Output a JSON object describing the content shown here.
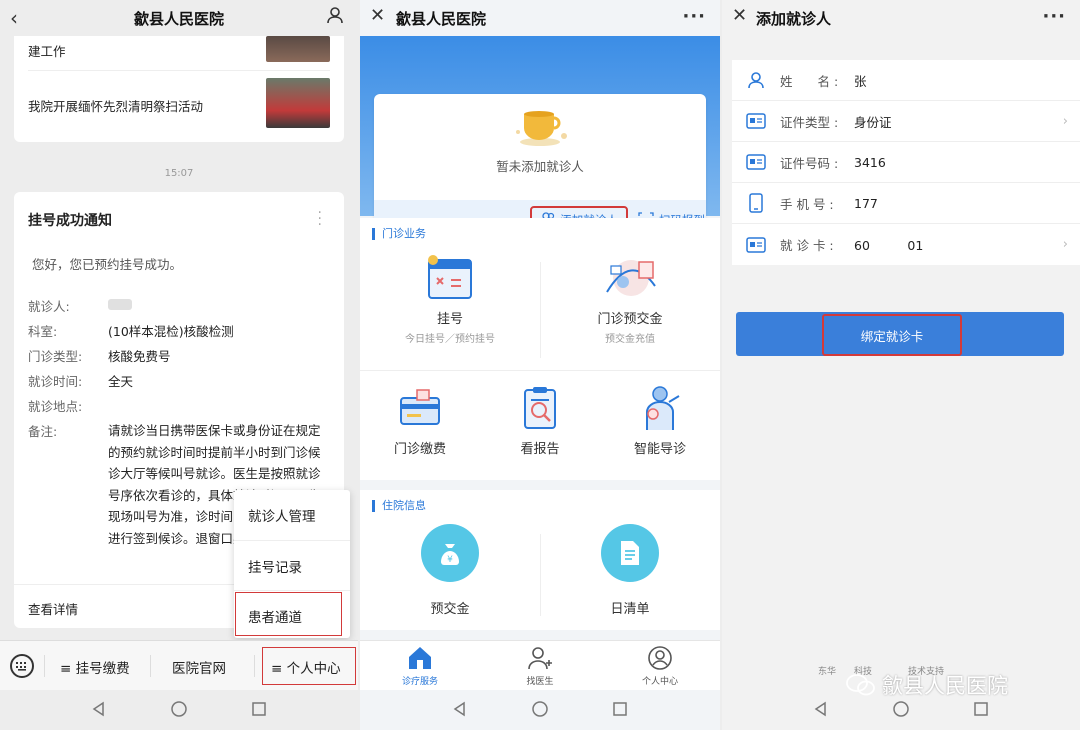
{
  "panel1": {
    "title": "歙县人民医院",
    "news": [
      {
        "title": "建工作"
      },
      {
        "title": "我院开展缅怀先烈清明祭扫活动"
      }
    ],
    "time": "15:07",
    "notice": {
      "title": "挂号成功通知",
      "greeting": "您好，您已预约挂号成功。",
      "fields": [
        {
          "label": "就诊人:",
          "value": ""
        },
        {
          "label": "科室:",
          "value": "(10样本混检)核酸检测"
        },
        {
          "label": "门诊类型:",
          "value": "核酸免费号"
        },
        {
          "label": "就诊时间:",
          "value": "全天"
        },
        {
          "label": "就诊地点:",
          "value": ""
        },
        {
          "label": "备注:",
          "value": ""
        }
      ],
      "note": "请就诊当日携带医保卡或身份证在规定的预约就诊时间时提前半小时到门诊候诊大厅等候叫号就诊。医生是按照就诊号序依次看诊的，具体就诊时间以医生现场叫号为准，诊时间，请持医保卡机进行签到候诊。退窗口办理。",
      "more": "查看详情"
    },
    "popup": [
      "就诊人管理",
      "挂号记录",
      "患者通道"
    ],
    "menu": [
      "≡ 挂号缴费",
      "医院官网",
      "≡ 个人中心"
    ]
  },
  "panel2": {
    "title": "歙县人民医院",
    "empty": "暂未添加就诊人",
    "add_patient": "添加就诊人",
    "scan": "扫码报到",
    "outpatient": {
      "header": "门诊业务",
      "tiles": [
        {
          "label": "挂号",
          "sub": "今日挂号／预约挂号"
        },
        {
          "label": "门诊预交金",
          "sub": "预交金充值"
        },
        {
          "label": "门诊缴费",
          "sub": ""
        },
        {
          "label": "看报告",
          "sub": ""
        },
        {
          "label": "智能导诊",
          "sub": ""
        }
      ]
    },
    "inpatient": {
      "header": "住院信息",
      "tiles": [
        {
          "label": "预交金",
          "glyph": "¥"
        },
        {
          "label": "日清单",
          "glyph": ""
        }
      ]
    },
    "tabs": [
      "诊疗服务",
      "找医生",
      "个人中心"
    ],
    "colors": {
      "primary": "#2a78d8",
      "highlight": "#d23a3a"
    }
  },
  "panel3": {
    "title": "添加就诊人",
    "fields": [
      {
        "label": "姓　　名 :",
        "value": "张"
      },
      {
        "label": "证件类型 :",
        "value": "身份证"
      },
      {
        "label": "证件号码 :",
        "value": "3416"
      },
      {
        "label": "手 机 号 :",
        "value": "177"
      },
      {
        "label": "就 诊 卡 :",
        "value": "60　　　01"
      }
    ],
    "bind": "绑定就诊卡",
    "footer": "东华　　科技　　　　技术支持",
    "watermark": "歙县人民医院"
  }
}
